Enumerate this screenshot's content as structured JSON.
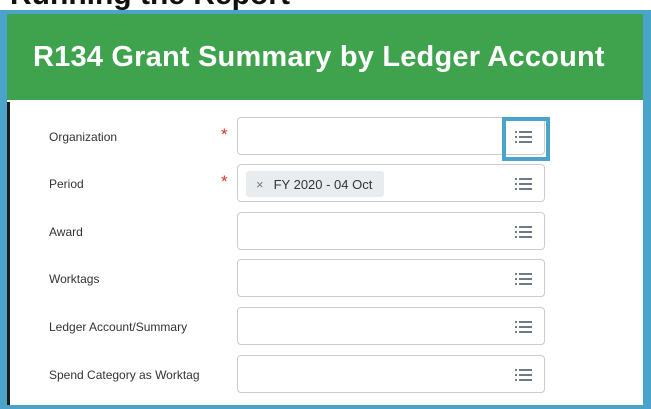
{
  "page": {
    "top_crop_text": "Running the Report"
  },
  "header": {
    "title": "R134 Grant Summary by Ledger Account"
  },
  "form": {
    "required_marker": "*",
    "prompt_icon": "list-prompt-icon",
    "fields": [
      {
        "label": "Organization",
        "required": true,
        "value": ""
      },
      {
        "label": "Period",
        "required": true,
        "value": "FY 2020 - 04 Oct",
        "remove_icon": "×"
      },
      {
        "label": "Award",
        "required": false,
        "value": ""
      },
      {
        "label": "Worktags",
        "required": false,
        "value": ""
      },
      {
        "label": "Ledger Account/Summary",
        "required": false,
        "value": ""
      },
      {
        "label": "Spend Category as Worktag",
        "required": false,
        "value": ""
      }
    ]
  },
  "colors": {
    "header_green": "#3fa34d",
    "frame_blue": "#4aa4c9",
    "required_red": "#d4332b"
  }
}
